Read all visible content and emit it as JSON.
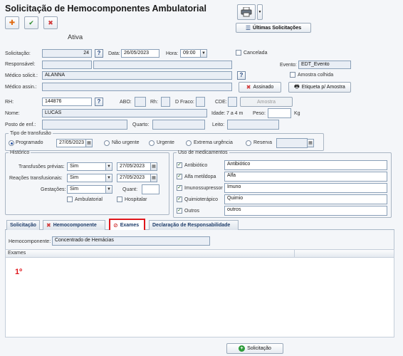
{
  "page": {
    "title": "Solicitação de Hemocomponentes Ambulatorial",
    "status": "Ativa",
    "ultimas_label": "Últimas Solicitações",
    "cancelada_label": "Cancelada",
    "amostra_colhida_label": "Amostra colhida",
    "evento_label": "Evento:",
    "evento_value": "EDT_Evento",
    "assinado_label": "Assinado",
    "etiqueta_label": "Etiqueta p/ Amostra",
    "amostra_label": "Amostra"
  },
  "form": {
    "solicitacao_label": "Solicitação:",
    "solicitacao_value": "24",
    "data_label": "Data:",
    "data_value": "26/05/2023",
    "hora_label": "Hora:",
    "hora_value": "09:00",
    "responsavel_label": "Responsável:",
    "medico_solic_label": "Médico solicit.:",
    "medico_solic_value": "ALANNA",
    "medico_assin_label": "Médico assin.:",
    "rh_label": "RH:",
    "rh_value": "144876",
    "abo_label": "ABO:",
    "rh2_label": "Rh:",
    "dfraco_label": "D Fraco:",
    "cde_label": "CDE:",
    "nome_label": "Nome:",
    "nome_value": "LUCAS",
    "idade_label": "Idade:",
    "idade_value": "7 a 4 m",
    "peso_label": "Peso:",
    "peso_unit": "Kg",
    "posto_label": "Posto de enf.:",
    "quarto_label": "Quarto:",
    "leito_label": "Leito:"
  },
  "transfusao": {
    "legend": "Tipo de transfusão",
    "options": [
      {
        "label": "Programado",
        "checked": true
      },
      {
        "label": "Não urgente",
        "checked": false
      },
      {
        "label": "Urgente",
        "checked": false
      },
      {
        "label": "Extrema urgência",
        "checked": false
      },
      {
        "label": "Reserva",
        "checked": false
      }
    ],
    "programado_date": "27/05/2023"
  },
  "historico": {
    "legend": "Histórico",
    "rows": [
      {
        "label": "Transfusões prévias:",
        "value": "Sim",
        "date": "27/05/2023"
      },
      {
        "label": "Reações transfusionais:",
        "value": "Sim",
        "date": "27/05/2023"
      },
      {
        "label": "Gestações:",
        "value": "Sim",
        "date": ""
      }
    ],
    "quant_label": "Quant:",
    "ambulatorial_label": "Ambulatorial",
    "hospitalar_label": "Hospitalar"
  },
  "medicamentos": {
    "legend": "Uso de medicamentos",
    "items": [
      {
        "label": "Antibiótico",
        "value": "Antibiótico",
        "checked": true
      },
      {
        "label": "Alfa metildopa",
        "value": "Alfa",
        "checked": true
      },
      {
        "label": "Imunossupressor",
        "value": "Imuno",
        "checked": true
      },
      {
        "label": "Quimioterápico",
        "value": "Quimio",
        "checked": true
      },
      {
        "label": "Outros",
        "value": "outros",
        "checked": true
      }
    ]
  },
  "tabs": [
    {
      "label": "Solicitação"
    },
    {
      "label": "Hemocomponente"
    },
    {
      "label": "Exames"
    },
    {
      "label": "Declaração de Responsabilidade"
    }
  ],
  "panel": {
    "hemocomponente_label": "Hemocomponente:",
    "hemocomponente_value": "Concentrado de Hemácias",
    "grid_header": "Exames",
    "annotation": "1º"
  },
  "footer": {
    "solicitacao_button": "Solicitação"
  },
  "colors": {
    "accent": "#1f3d6a",
    "highlight": "#e0161b",
    "background": "#f4f6f9"
  }
}
